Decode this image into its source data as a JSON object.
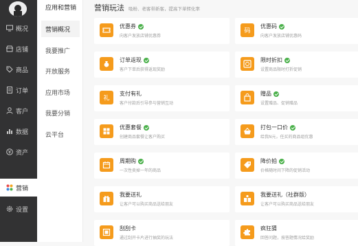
{
  "nav": {
    "items": [
      {
        "label": "概况",
        "icon": "monitor-icon"
      },
      {
        "label": "店铺",
        "icon": "store-icon"
      },
      {
        "label": "商品",
        "icon": "tag-icon"
      },
      {
        "label": "订单",
        "icon": "document-icon"
      },
      {
        "label": "客户",
        "icon": "person-icon"
      },
      {
        "label": "数据",
        "icon": "bar-chart-icon"
      },
      {
        "label": "资产",
        "icon": "yen-circle-icon"
      },
      {
        "label": "营销",
        "icon": "grid-dots-icon"
      },
      {
        "label": "设置",
        "icon": "gear-icon"
      }
    ]
  },
  "subnav": {
    "title": "应用和营销",
    "items": [
      "营销概况",
      "我要推广",
      "开放服务",
      "应用市场",
      "我要分销",
      "云平台"
    ]
  },
  "main": {
    "title": "营销玩法",
    "subtitle": "吸粉、老客带新客，提高下单转化率",
    "cards": [
      {
        "name": "优惠券",
        "desc": "向客户发放店铺优惠券",
        "icon": "ticket-icon",
        "check": true
      },
      {
        "name": "优惠码",
        "desc": "向客户发放店铺优惠码",
        "icon": "code-icon",
        "check": true
      },
      {
        "name": "订单返现",
        "desc": "客户下单后获得返现奖励",
        "icon": "money-bag-icon",
        "check": true
      },
      {
        "name": "限时折扣",
        "desc": "设置商品限时打折促销",
        "icon": "clock-icon",
        "check": true
      },
      {
        "name": "支付有礼",
        "desc": "客户付款后引导参与营销互动",
        "icon": "gift-ribbon-icon",
        "check": false
      },
      {
        "name": "赠品",
        "desc": "设置赠品、促销赠品",
        "icon": "shopping-bag-icon",
        "check": true
      },
      {
        "name": "优惠套餐",
        "desc": "创建商品套餐让客户购买",
        "icon": "package-icon",
        "check": true
      },
      {
        "name": "打包一口价",
        "desc": "给我N元，任买的商品组优惠",
        "icon": "basket-icon",
        "check": true
      },
      {
        "name": "周期购",
        "desc": "一次性卖掉一年的商品",
        "icon": "calendar-icon",
        "check": true
      },
      {
        "name": "降价拍",
        "desc": "价格随时间下降的促销活动",
        "icon": "price-tag-icon",
        "check": true
      },
      {
        "name": "我要送礼",
        "desc": "让客户可以购买商品送给朋友",
        "icon": "gift-box-icon",
        "check": false
      },
      {
        "name": "我要送礼（社群版）",
        "desc": "让客户可以购买商品送给朋友",
        "icon": "group-gift-icon",
        "check": false
      },
      {
        "name": "刮刮卡",
        "desc": "通过刮开卡片进行抽奖的玩法",
        "icon": "scratch-card-icon",
        "check": false
      },
      {
        "name": "疯狂猜",
        "desc": "回答问题，按答题情况给奖励",
        "icon": "puzzle-icon",
        "check": false
      }
    ]
  },
  "colors": {
    "nav_bg": "#323233",
    "accent_orange": "#f59b1c",
    "check_green": "#4ab04a"
  }
}
